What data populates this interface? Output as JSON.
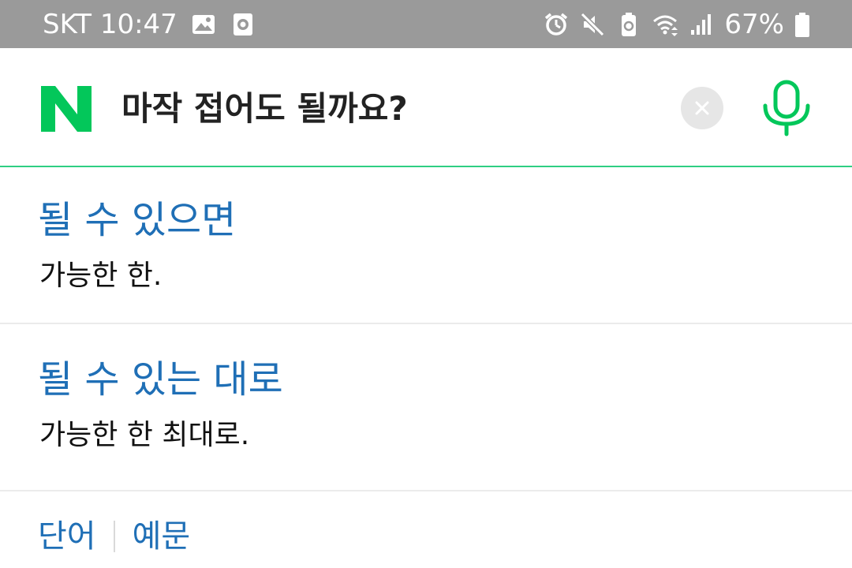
{
  "status_bar": {
    "carrier_time": "SKT 10:47",
    "battery": "67%",
    "left_icons": [
      "image-icon",
      "screen-recorder-icon"
    ],
    "right_icons": [
      "alarm-icon",
      "mute-icon",
      "battery-saver-icon",
      "wifi-icon",
      "signal-icon",
      "battery-icon"
    ]
  },
  "search": {
    "query": "마작 접어도 될까요?",
    "logo_icon": "naver-logo-icon",
    "clear_icon": "close-icon",
    "mic_icon": "microphone-icon"
  },
  "results": [
    {
      "title": "될 수 있으면",
      "description": "가능한 한."
    },
    {
      "title": "될 수 있는 대로",
      "description": "가능한 한 최대로."
    }
  ],
  "tabs": [
    {
      "label": "단어"
    },
    {
      "label": "예문"
    }
  ],
  "colors": {
    "accent": "#03c75a",
    "link": "#1f6fb6",
    "status_bar": "#9a9a9a",
    "header_border": "#2fcf83"
  }
}
